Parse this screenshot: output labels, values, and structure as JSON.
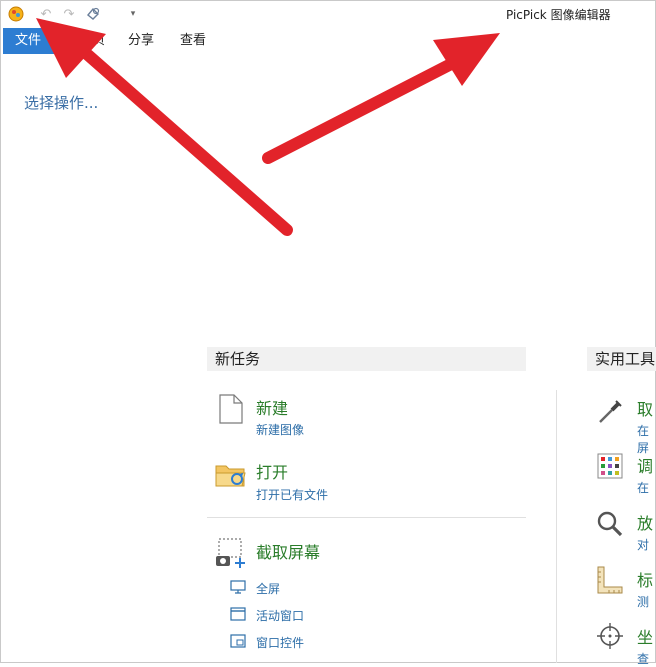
{
  "titlebar": {
    "app_title": "PicPick 图像编辑器"
  },
  "ribbon": {
    "tabs": [
      {
        "label": "文件"
      },
      {
        "label": "页"
      },
      {
        "label": "分享"
      },
      {
        "label": "查看"
      }
    ]
  },
  "left_panel": {
    "prompt": "选择操作..."
  },
  "new_task": {
    "header": "新任务",
    "items": [
      {
        "title": "新建",
        "subtitle": "新建图像"
      },
      {
        "title": "打开",
        "subtitle": "打开已有文件"
      }
    ],
    "capture": {
      "title": "截取屏幕",
      "options": [
        {
          "label": "全屏"
        },
        {
          "label": "活动窗口"
        },
        {
          "label": "窗口控件"
        }
      ]
    }
  },
  "tools": {
    "header": "实用工具",
    "items": [
      {
        "title": "取",
        "subtitle": "在屏"
      },
      {
        "title": "调",
        "subtitle": "在"
      },
      {
        "title": "放",
        "subtitle": "对"
      },
      {
        "title": "标",
        "subtitle": "测"
      },
      {
        "title": "坐",
        "subtitle": "查"
      }
    ]
  },
  "colors": {
    "file_tab": "#2d7dd2",
    "title_green": "#2a7d2a",
    "sub_blue": "#2d6ea8",
    "arrow_red": "#e2232a"
  }
}
